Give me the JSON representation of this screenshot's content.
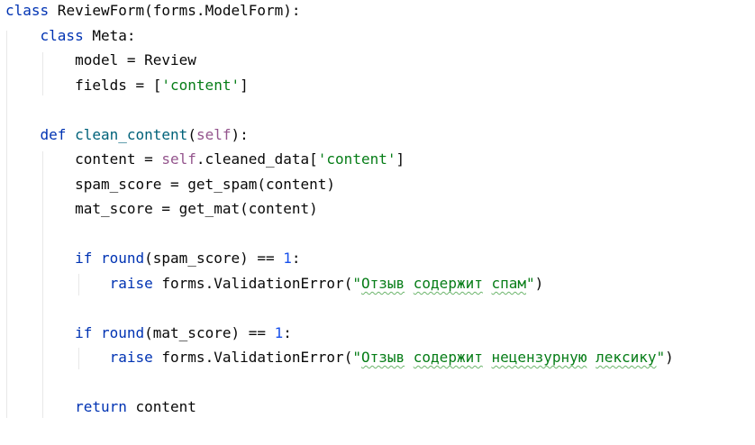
{
  "code_lines": [
    {
      "id": 0,
      "indent": "",
      "tokens": [
        {
          "t": "kw",
          "v": "class"
        },
        {
          "t": "plain",
          "v": " ReviewForm(forms.ModelForm):"
        }
      ]
    },
    {
      "id": 1,
      "indent": "    ",
      "tokens": [
        {
          "t": "kw",
          "v": "class"
        },
        {
          "t": "plain",
          "v": " Meta:"
        }
      ]
    },
    {
      "id": 2,
      "indent": "        ",
      "tokens": [
        {
          "t": "plain",
          "v": "model = Review"
        }
      ]
    },
    {
      "id": 3,
      "indent": "        ",
      "tokens": [
        {
          "t": "plain",
          "v": "fields = ["
        },
        {
          "t": "str",
          "v": "'content'"
        },
        {
          "t": "plain",
          "v": "]"
        }
      ]
    },
    {
      "id": 4,
      "indent": "",
      "tokens": []
    },
    {
      "id": 5,
      "indent": "    ",
      "tokens": [
        {
          "t": "kw",
          "v": "def"
        },
        {
          "t": "plain",
          "v": " "
        },
        {
          "t": "fn",
          "v": "clean_content"
        },
        {
          "t": "plain",
          "v": "("
        },
        {
          "t": "self",
          "v": "self"
        },
        {
          "t": "plain",
          "v": "):"
        }
      ]
    },
    {
      "id": 6,
      "indent": "        ",
      "tokens": [
        {
          "t": "plain",
          "v": "content = "
        },
        {
          "t": "self",
          "v": "self"
        },
        {
          "t": "plain",
          "v": ".cleaned_data["
        },
        {
          "t": "str",
          "v": "'content'"
        },
        {
          "t": "plain",
          "v": "]"
        }
      ]
    },
    {
      "id": 7,
      "indent": "        ",
      "tokens": [
        {
          "t": "plain",
          "v": "spam_score = get_spam(content)"
        }
      ]
    },
    {
      "id": 8,
      "indent": "        ",
      "tokens": [
        {
          "t": "plain",
          "v": "mat_score = get_mat(content)"
        }
      ]
    },
    {
      "id": 9,
      "indent": "",
      "tokens": []
    },
    {
      "id": 10,
      "indent": "        ",
      "tokens": [
        {
          "t": "kw",
          "v": "if"
        },
        {
          "t": "plain",
          "v": " "
        },
        {
          "t": "kw",
          "v": "round"
        },
        {
          "t": "plain",
          "v": "(spam_score) == "
        },
        {
          "t": "num",
          "v": "1"
        },
        {
          "t": "plain",
          "v": ":"
        }
      ]
    },
    {
      "id": 11,
      "indent": "            ",
      "tokens": [
        {
          "t": "kw",
          "v": "raise"
        },
        {
          "t": "plain",
          "v": " forms.ValidationError("
        },
        {
          "t": "str",
          "v": "\""
        },
        {
          "t": "strtypo",
          "v": "Отзыв"
        },
        {
          "t": "str",
          "v": " "
        },
        {
          "t": "strtypo",
          "v": "содержит"
        },
        {
          "t": "str",
          "v": " "
        },
        {
          "t": "strtypo",
          "v": "спам"
        },
        {
          "t": "str",
          "v": "\""
        },
        {
          "t": "plain",
          "v": ")"
        }
      ]
    },
    {
      "id": 12,
      "indent": "",
      "tokens": []
    },
    {
      "id": 13,
      "indent": "        ",
      "tokens": [
        {
          "t": "kw",
          "v": "if"
        },
        {
          "t": "plain",
          "v": " "
        },
        {
          "t": "kw",
          "v": "round"
        },
        {
          "t": "plain",
          "v": "(mat_score) == "
        },
        {
          "t": "num",
          "v": "1"
        },
        {
          "t": "plain",
          "v": ":"
        }
      ]
    },
    {
      "id": 14,
      "indent": "            ",
      "tokens": [
        {
          "t": "kw",
          "v": "raise"
        },
        {
          "t": "plain",
          "v": " forms.ValidationError("
        },
        {
          "t": "str",
          "v": "\""
        },
        {
          "t": "strtypo",
          "v": "Отзыв"
        },
        {
          "t": "str",
          "v": " "
        },
        {
          "t": "strtypo",
          "v": "содержит"
        },
        {
          "t": "str",
          "v": " "
        },
        {
          "t": "strtypo",
          "v": "нецензурную"
        },
        {
          "t": "str",
          "v": " "
        },
        {
          "t": "strtypo",
          "v": "лексику"
        },
        {
          "t": "str",
          "v": "\""
        },
        {
          "t": "plain",
          "v": ")"
        }
      ]
    },
    {
      "id": 15,
      "indent": "",
      "tokens": []
    },
    {
      "id": 16,
      "indent": "        ",
      "tokens": [
        {
          "t": "kw",
          "v": "return"
        },
        {
          "t": "plain",
          "v": " content"
        }
      ]
    }
  ],
  "colors": {
    "keyword": "#0033b3",
    "string": "#067d17",
    "number": "#1750eb",
    "self": "#94558d",
    "function": "#00627a",
    "text": "#080808",
    "indent_guide": "#e8e8e8",
    "typo_underline": "#6cb56c"
  }
}
